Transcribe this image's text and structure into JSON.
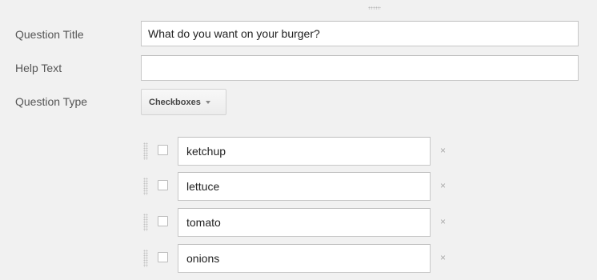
{
  "form": {
    "question_title_label": "Question Title",
    "question_title_value": "What do you want on your burger?",
    "help_text_label": "Help Text",
    "help_text_value": "",
    "question_type_label": "Question Type",
    "question_type_value": "Checkboxes"
  },
  "options": [
    {
      "value": "ketchup",
      "remove": "×"
    },
    {
      "value": "lettuce",
      "remove": "×"
    },
    {
      "value": "tomato",
      "remove": "×"
    },
    {
      "value": "onions",
      "remove": "×"
    }
  ],
  "icons": {
    "drag": "drag-handle-icon",
    "caret": "chevron-down-icon",
    "remove": "close-icon"
  }
}
